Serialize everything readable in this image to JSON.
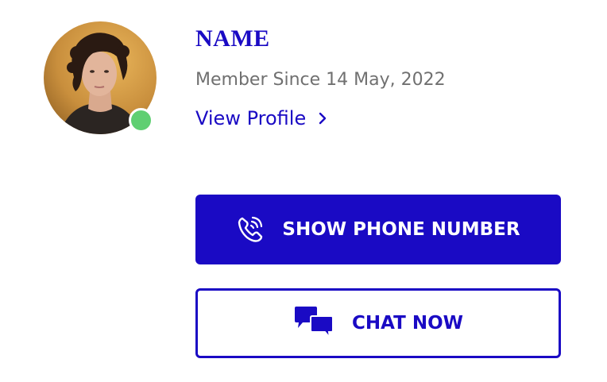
{
  "profile": {
    "name": "NAME",
    "member_since": "Member Since 14 May, 2022",
    "view_profile_label": "View Profile",
    "status": "online"
  },
  "actions": {
    "show_phone_label": "SHOW PHONE NUMBER",
    "chat_label": "CHAT NOW"
  },
  "icons": {
    "phone": "phone-call-icon",
    "chat": "chat-bubbles-icon",
    "chevron": "chevron-right-icon"
  },
  "colors": {
    "accent": "#1a0ac4",
    "muted_text": "#707070",
    "online": "#5fcf72"
  }
}
